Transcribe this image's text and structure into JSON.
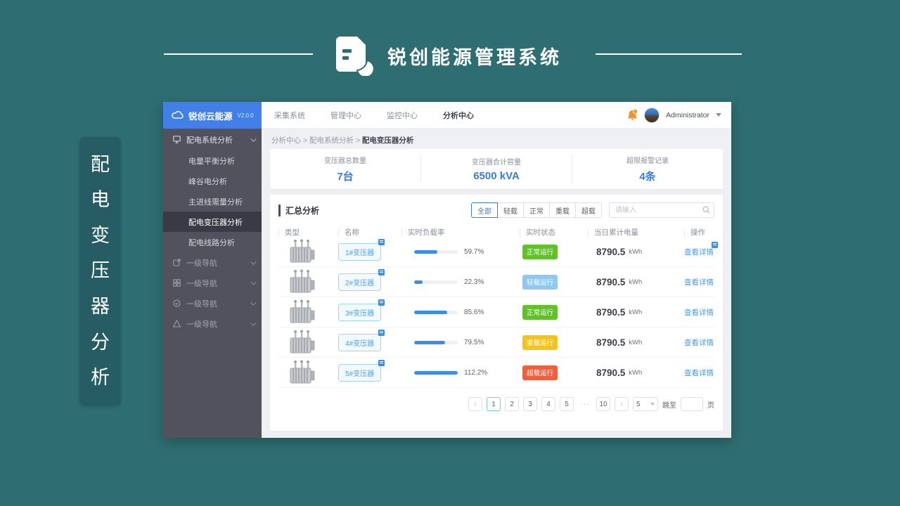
{
  "page": {
    "title": "锐创能源管理系统",
    "side_tag_chars": [
      "配",
      "电",
      "变",
      "压",
      "器",
      "分",
      "析"
    ]
  },
  "sidebar": {
    "brand": "锐创云能源",
    "version": "V2.0.0",
    "parent_item": "配电系统分析",
    "submenu": [
      "电量平衡分析",
      "峰谷电分析",
      "主进线需量分析",
      "配电变压器分析",
      "配电线路分析"
    ],
    "active_submenu": "配电变压器分析",
    "nav_group_label_1": "一级导航",
    "nav_group_label_2": "一级导航",
    "nav_group_label_3": "一级导航",
    "nav_group_label_4": "一级导航"
  },
  "topnav": {
    "items": [
      "采集系统",
      "管理中心",
      "监控中心",
      "分析中心"
    ],
    "active_item": "分析中心",
    "user_name": "Administrator"
  },
  "breadcrumb": {
    "text": "分析中心 > 配电系统分析 > ",
    "current": "配电变压器分析"
  },
  "stats": [
    {
      "label": "变压器总数量",
      "value": "7台"
    },
    {
      "label": "变压器合计容量",
      "value": "6500 kVA"
    },
    {
      "label": "超限报警记录",
      "value": "4条"
    }
  ],
  "summary": {
    "title": "汇总分析",
    "filters": [
      "全部",
      "轻载",
      "正常",
      "重载",
      "超载"
    ],
    "active_filter": "全部",
    "search_placeholder": "请输入"
  },
  "table": {
    "headers": [
      "类型",
      "名称",
      "实时负载率",
      "实时状态",
      "当日累计电量",
      "操作"
    ],
    "rows": [
      {
        "name": "1#变压器",
        "load": "59.7%",
        "bar": 53,
        "status": "正常运行",
        "status_type": "normal",
        "energy": "8790.5",
        "unit": "kWh",
        "action": "查看详情"
      },
      {
        "name": "2#变压器",
        "load": "22.3%",
        "bar": 20,
        "status": "轻载运行",
        "status_type": "light",
        "energy": "8790.5",
        "unit": "kWh",
        "action": "查看详情"
      },
      {
        "name": "3#变压器",
        "load": "85.6%",
        "bar": 76,
        "status": "正常运行",
        "status_type": "normal",
        "energy": "8790.5",
        "unit": "kWh",
        "action": "查看详情"
      },
      {
        "name": "4#变压器",
        "load": "79.5%",
        "bar": 71,
        "status": "重载运行",
        "status_type": "heavy",
        "energy": "8790.5",
        "unit": "kWh",
        "action": "查看详情"
      },
      {
        "name": "5#变压器",
        "load": "112.2%",
        "bar": 100,
        "status": "超载运行",
        "status_type": "over",
        "energy": "8790.5",
        "unit": "kWh",
        "action": "查看详情"
      }
    ]
  },
  "pagination": {
    "prev": "‹",
    "next": "›",
    "pages": [
      "1",
      "2",
      "3",
      "4",
      "5"
    ],
    "ellipsis": "···",
    "last_page": "10",
    "active_page": "1",
    "page_size": "5",
    "jump_prefix": "跳至",
    "jump_suffix": "页"
  }
}
